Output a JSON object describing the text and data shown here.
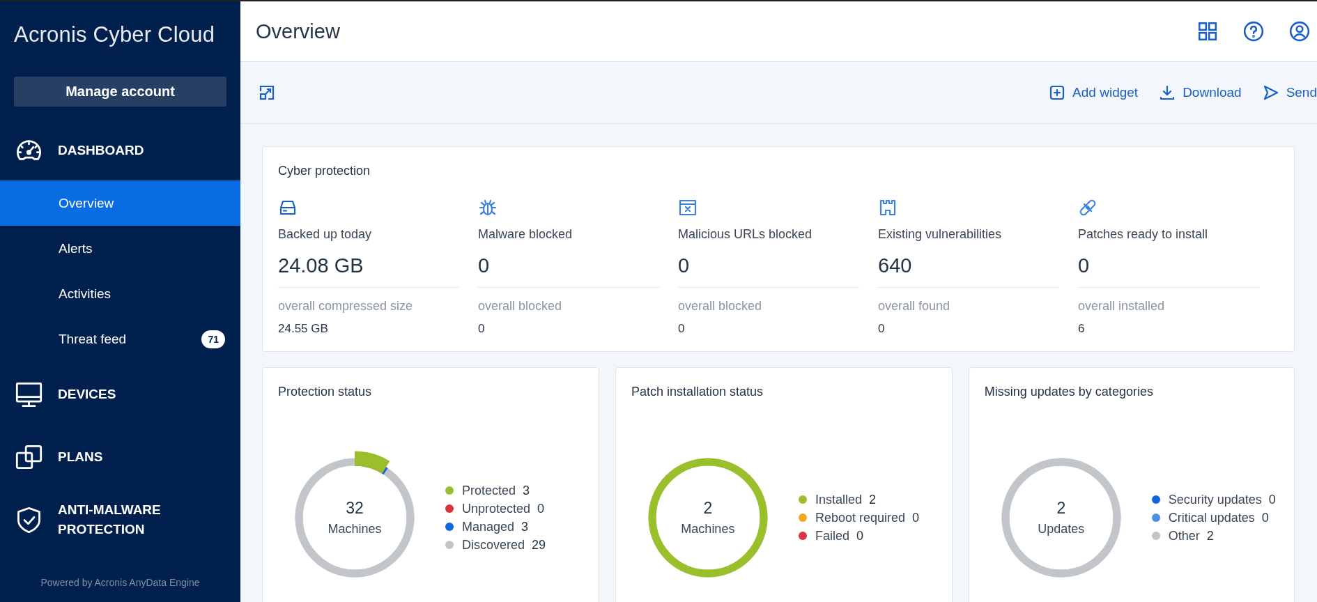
{
  "sidebar": {
    "logo": "**Acronis** Cyber Cloud",
    "manage_button": "Manage account",
    "sections": [
      {
        "label": "DASHBOARD",
        "items": [
          {
            "label": "Overview",
            "selected": true
          },
          {
            "label": "Alerts",
            "selected": false
          },
          {
            "label": "Activities",
            "selected": false
          },
          {
            "label": "Threat feed",
            "selected": false,
            "badge": "71"
          }
        ]
      },
      {
        "label": "DEVICES"
      },
      {
        "label": "PLANS"
      },
      {
        "label": "ANTI-MALWARE PROTECTION"
      }
    ],
    "footer": "Powered by Acronis AnyData Engine"
  },
  "header": {
    "title": "Overview"
  },
  "toolbar": {
    "actions": [
      {
        "label": "Add widget"
      },
      {
        "label": "Download"
      },
      {
        "label": "Send"
      }
    ]
  },
  "cyber_protection": {
    "title": "Cyber protection",
    "metrics": [
      {
        "label": "Backed up today",
        "value": "24.08 GB",
        "sub_label": "overall compressed size",
        "sub_value": "24.55 GB"
      },
      {
        "label": "Malware blocked",
        "value": "0",
        "sub_label": "overall blocked",
        "sub_value": "0"
      },
      {
        "label": "Malicious URLs blocked",
        "value": "0",
        "sub_label": "overall blocked",
        "sub_value": "0"
      },
      {
        "label": "Existing vulnerabilities",
        "value": "640",
        "sub_label": "overall found",
        "sub_value": "0"
      },
      {
        "label": "Patches ready to install",
        "value": "0",
        "sub_label": "overall installed",
        "sub_value": "6"
      }
    ]
  },
  "widgets": [
    {
      "title": "Protection status",
      "total": "32",
      "unit": "Machines",
      "legend": [
        {
          "label": "Protected",
          "value": "3",
          "color": "#9bbf2a"
        },
        {
          "label": "Unprotected",
          "value": "0",
          "color": "#d9333f"
        },
        {
          "label": "Managed",
          "value": "3",
          "color": "#1066e0"
        },
        {
          "label": "Discovered",
          "value": "29",
          "color": "#c2c5c9"
        }
      ]
    },
    {
      "title": "Patch installation status",
      "total": "2",
      "unit": "Machines",
      "legend": [
        {
          "label": "Installed",
          "value": "2",
          "color": "#9bbf2a"
        },
        {
          "label": "Reboot required",
          "value": "0",
          "color": "#f5a623"
        },
        {
          "label": "Failed",
          "value": "0",
          "color": "#d9333f"
        }
      ]
    },
    {
      "title": "Missing updates by categories",
      "total": "2",
      "unit": "Updates",
      "legend": [
        {
          "label": "Security updates",
          "value": "0",
          "color": "#1066e0"
        },
        {
          "label": "Critical updates",
          "value": "0",
          "color": "#4a90e2"
        },
        {
          "label": "Other",
          "value": "2",
          "color": "#c2c5c9"
        }
      ]
    }
  ]
}
